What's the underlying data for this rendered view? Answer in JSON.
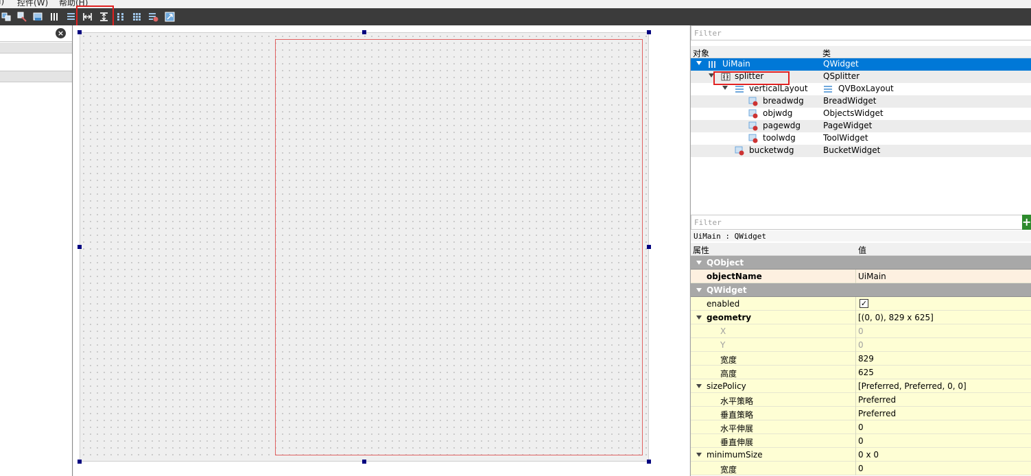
{
  "menubar": {
    "items": [
      "I)",
      "控件(W)",
      "帮助(H)"
    ]
  },
  "toolbar": {
    "buttons": [
      {
        "name": "edit-widgets-icon"
      },
      {
        "name": "edit-signals-icon"
      },
      {
        "name": "edit-buddies-icon"
      },
      {
        "name": "layout-horizontal-icon"
      },
      {
        "name": "layout-vertical-icon"
      },
      {
        "name": "splitter-horizontal-icon"
      },
      {
        "name": "splitter-vertical-icon"
      },
      {
        "name": "layout-form-icon"
      },
      {
        "name": "layout-grid-icon"
      },
      {
        "name": "break-layout-icon"
      },
      {
        "name": "adjust-size-icon"
      }
    ]
  },
  "left_panel": {
    "clear_icon": "×"
  },
  "object_inspector": {
    "filter_placeholder": "Filter",
    "col_object": "对象",
    "col_class": "类",
    "rows": [
      {
        "name": "UiMain",
        "cls": "QWidget",
        "selected": true,
        "icon": "vertical-layout-icon"
      },
      {
        "name": "splitter",
        "cls": "QSplitter",
        "icon": "splitter-icon"
      },
      {
        "name": "verticalLayout",
        "cls": "QVBoxLayout",
        "icon": "vboxlayout-icon"
      },
      {
        "name": "breadwdg",
        "cls": "BreadWidget",
        "icon": "widget-icon"
      },
      {
        "name": "objwdg",
        "cls": "ObjectsWidget",
        "icon": "widget-icon"
      },
      {
        "name": "pagewdg",
        "cls": "PageWidget",
        "icon": "widget-icon"
      },
      {
        "name": "toolwdg",
        "cls": "ToolWidget",
        "icon": "widget-icon"
      },
      {
        "name": "bucketwdg",
        "cls": "BucketWidget",
        "icon": "widget-icon"
      }
    ]
  },
  "property_editor": {
    "filter_placeholder": "Filter",
    "plus_label": "+",
    "title": "UiMain : QWidget",
    "col_property": "属性",
    "col_value": "值",
    "rows": [
      {
        "name": "QObject",
        "value": ""
      },
      {
        "name": "objectName",
        "value": "UiMain"
      },
      {
        "name": "QWidget",
        "value": ""
      },
      {
        "name": "enabled",
        "value": "✓"
      },
      {
        "name": "geometry",
        "value": "[(0, 0), 829 x 625]"
      },
      {
        "name": "X",
        "value": "0"
      },
      {
        "name": "Y",
        "value": "0"
      },
      {
        "name": "宽度",
        "value": "829"
      },
      {
        "name": "高度",
        "value": "625"
      },
      {
        "name": "sizePolicy",
        "value": "[Preferred, Preferred, 0, 0]"
      },
      {
        "name": "水平策略",
        "value": "Preferred"
      },
      {
        "name": "垂直策略",
        "value": "Preferred"
      },
      {
        "name": "水平伸展",
        "value": "0"
      },
      {
        "name": "垂直伸展",
        "value": "0"
      },
      {
        "name": "minimumSize",
        "value": "0 x 0"
      },
      {
        "name": "宽度",
        "value": "0"
      }
    ]
  },
  "colors": {
    "selection": "#0078d7",
    "highlight_box": "#e02020",
    "category_row": "#a8a8a8",
    "property_row": "#fefed4"
  }
}
